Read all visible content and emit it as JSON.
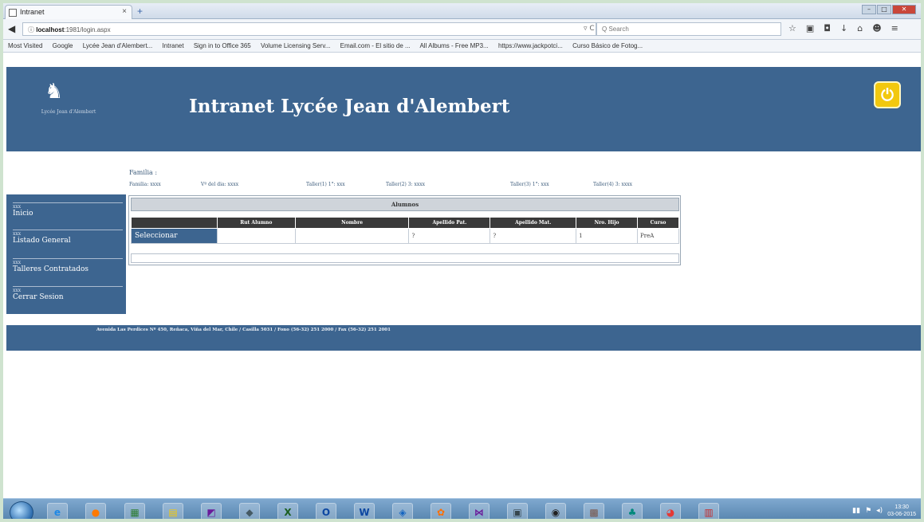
{
  "browser": {
    "tab_title": "Intranet",
    "tab_close": "×",
    "new_tab": "+",
    "url_host": "localhost",
    "url_path": ":1981/login.aspx",
    "reload_text": "▿ C",
    "search_placeholder": "Q Search",
    "bookmarks": [
      "Most Visited",
      "Google",
      "Lycée Jean d'Alembert...",
      "Intranet",
      "Sign in to Office 365",
      "Volume Licensing Serv...",
      "Email.com - El sitio de ...",
      "All Albums - Free MP3...",
      "https://www.jackpotci...",
      "Curso Básico de Fotog..."
    ]
  },
  "header": {
    "site_title": "Intranet Lycée Jean d'Alembert",
    "logo_caption": "Lycée Jean d'Alembert"
  },
  "family": {
    "label": "Familia :",
    "fields": [
      "Familia: xxxx",
      "Vº del dia: xxxx",
      "Taller(1) 1°: xxx",
      "Taller(2) 3: xxxx",
      "Taller(3) 1°: xxx",
      "Taller(4) 3: xxxx"
    ]
  },
  "sidebar": {
    "items": [
      {
        "num": "xxx",
        "label": "Inicio"
      },
      {
        "num": "xxx",
        "label": "Listado General"
      },
      {
        "num": "xxx",
        "label": "Talleres Contratados"
      },
      {
        "num": "xxx",
        "label": "Cerrar Sesion"
      }
    ]
  },
  "grid": {
    "caption": "Alumnos",
    "columns": [
      "",
      "Rut Alumno",
      "Nombre",
      "Apellido Pat.",
      "Apellido Mat.",
      "Nro. Hijo",
      "Curso"
    ],
    "rows": [
      {
        "action": "Seleccionar",
        "rut": "",
        "nombre": "",
        "apellido_pat": "?",
        "apellido_mat": "?",
        "nro_hijo": "1",
        "curso": "PreA"
      }
    ]
  },
  "footer": {
    "address": "Avenida Las Perdices Nº 450, Reñaca, Viña del Mar, Chile / Casilla 5031 / Fono (56-32) 251 2000 / Fax (56-32) 251 2001"
  },
  "taskbar": {
    "clock_time": "13:30",
    "clock_date": "03-06-2015"
  },
  "colors": {
    "brand_blue": "#3d6590",
    "power_yellow": "#f2c80e"
  }
}
